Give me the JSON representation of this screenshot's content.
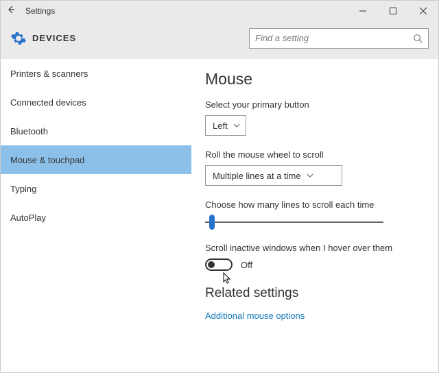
{
  "window": {
    "title": "Settings"
  },
  "header": {
    "section": "DEVICES",
    "search_placeholder": "Find a setting"
  },
  "sidebar": {
    "items": [
      {
        "label": "Printers & scanners",
        "selected": false
      },
      {
        "label": "Connected devices",
        "selected": false
      },
      {
        "label": "Bluetooth",
        "selected": false
      },
      {
        "label": "Mouse & touchpad",
        "selected": true
      },
      {
        "label": "Typing",
        "selected": false
      },
      {
        "label": "AutoPlay",
        "selected": false
      }
    ]
  },
  "main": {
    "heading": "Mouse",
    "primary_button_label": "Select your primary button",
    "primary_button_value": "Left",
    "wheel_label": "Roll the mouse wheel to scroll",
    "wheel_value": "Multiple lines at a time",
    "lines_label": "Choose how many lines to scroll each time",
    "hover_label": "Scroll inactive windows when I hover over them",
    "hover_value": "Off",
    "related_heading": "Related settings",
    "additional_link": "Additional mouse options"
  }
}
